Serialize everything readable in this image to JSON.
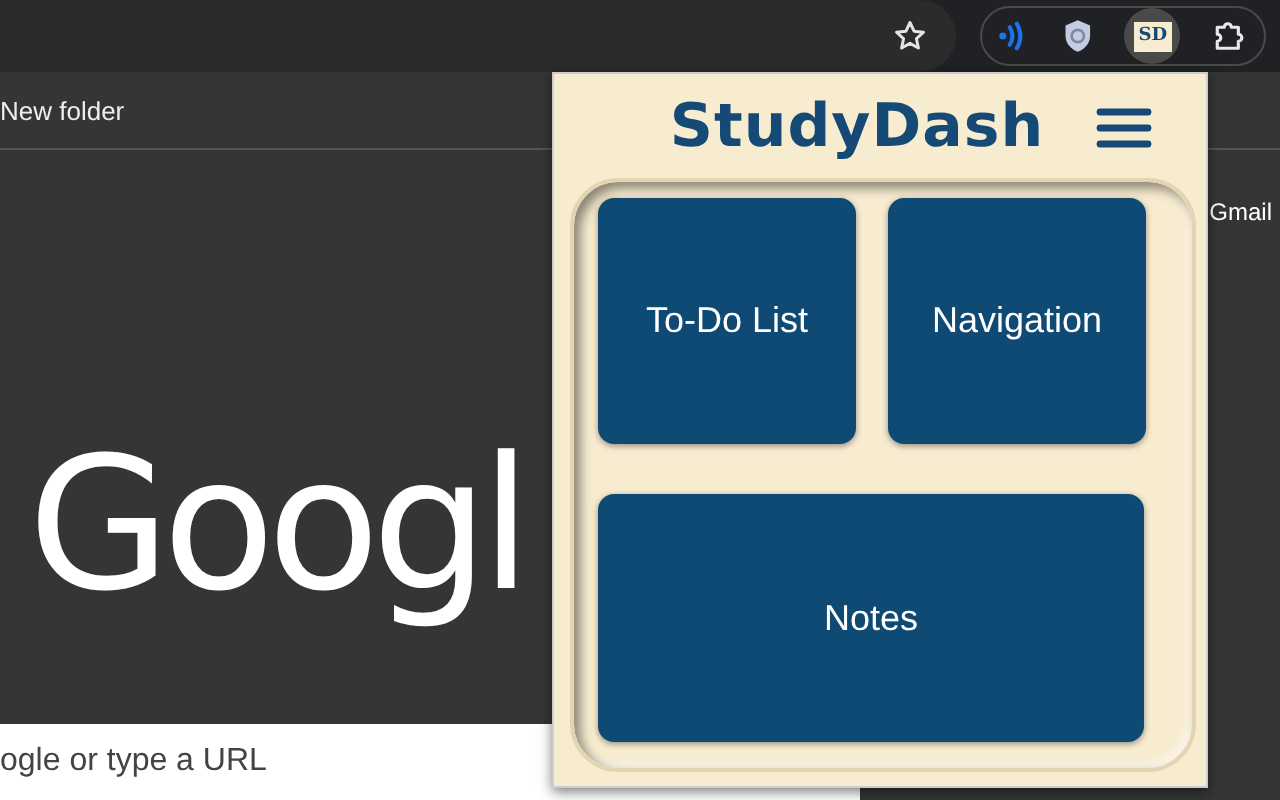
{
  "toolbar": {
    "extensions": [
      {
        "kind": "signal"
      },
      {
        "kind": "shield"
      },
      {
        "kind": "badge",
        "label": "SD",
        "selected": true
      },
      {
        "kind": "puzzle"
      }
    ]
  },
  "bookmarks_bar": {
    "items": [
      "New folder"
    ]
  },
  "page": {
    "top_link": "Gmail",
    "logo": "Googl",
    "search": {
      "placeholder": "ogle or type a URL"
    }
  },
  "popup": {
    "title": "StudyDash",
    "tiles": [
      {
        "label": "To-Do List",
        "wide": false
      },
      {
        "label": "Navigation",
        "wide": false
      },
      {
        "label": "Notes",
        "wide": true
      }
    ]
  }
}
